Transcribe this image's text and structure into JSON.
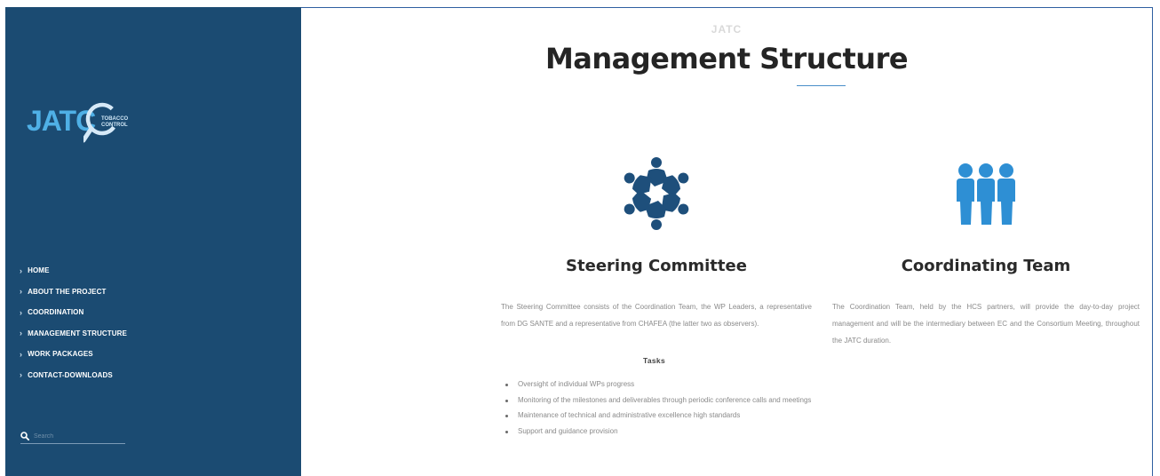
{
  "sidebar": {
    "logo": {
      "text": "JATC",
      "small_lines": [
        "TOBACCO",
        "CONTROL"
      ]
    },
    "nav": [
      "HOME",
      "ABOUT THE PROJECT",
      "COORDINATION",
      "MANAGEMENT STRUCTURE",
      "WORK PACKAGES",
      "CONTACT-DOWNLOADS"
    ],
    "search": {
      "placeholder": "Search"
    }
  },
  "main": {
    "kicker": "JATC",
    "title": "Management Structure",
    "steering": {
      "icon": "circle-of-people-icon",
      "heading": "Steering Committee",
      "text": "The Steering Committee consists of the Coordination Team, the WP Leaders, a representative from DG SANTE and a representative from CHAFEA (the latter two as observers).",
      "tasks_heading": "Tasks",
      "tasks": [
        "Oversight of individual WPs progress",
        "Monitoring of the milestones and deliverables through periodic conference calls and meetings",
        "Maintenance of technical and administrative excellence high standards",
        "Support and guidance provision"
      ]
    },
    "coordinating": {
      "icon": "team-icon",
      "heading": "Coordinating Team",
      "text": "The Coordination Team, held by the HCS partners, will provide the day-to-day project management and will be the intermediary between EC and the Consortium Meeting, throughout the JATC duration."
    }
  },
  "colors": {
    "sidebar": "#1b4b72",
    "logo": "#4fb0e6",
    "steering_icon": "#1e4f7b",
    "team_icon": "#2e8fd4",
    "accent_rule": "#4a8fc9"
  }
}
